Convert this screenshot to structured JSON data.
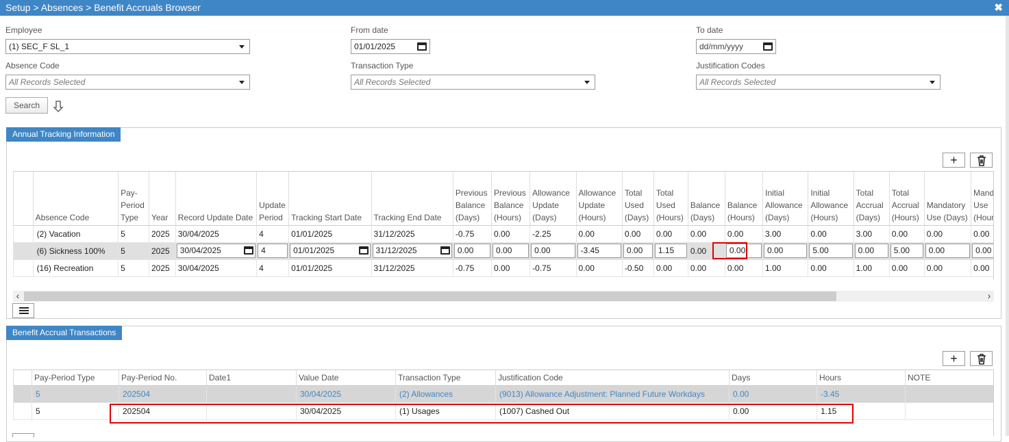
{
  "window": {
    "title": "Setup > Absences > Benefit Accruals Browser",
    "close_symbol": "✖"
  },
  "filters": {
    "employee": {
      "label": "Employee",
      "value": "(1) SEC_F SL_1"
    },
    "from_date": {
      "label": "From date",
      "value": "01/01/2025"
    },
    "to_date": {
      "label": "To date",
      "placeholder": "dd/mm/yyyy"
    },
    "absence_code": {
      "label": "Absence Code",
      "value": "All Records Selected"
    },
    "transaction_type": {
      "label": "Transaction Type",
      "value": "All Records Selected"
    },
    "justification_codes": {
      "label": "Justification Codes",
      "value": "All Records Selected"
    },
    "search_label": "Search"
  },
  "annual": {
    "tab_label": "Annual Tracking Information",
    "columns": [
      "",
      "Absence Code",
      "Pay-Period Type",
      "Year",
      "Record Update Date",
      "Update Period",
      "Tracking Start Date",
      "Tracking End Date",
      "Previous Balance (Days)",
      "Previous Balance (Hours)",
      "Allowance Update (Days)",
      "Allowance Update (Hours)",
      "Total Used (Days)",
      "Total Used (Hours)",
      "Balance (Days)",
      "Balance (Hours)",
      "Initial Allowance (Days)",
      "Initial Allowance (Hours)",
      "Total Accrual (Days)",
      "Total Accrual (Hours)",
      "Mandatory Use (Days)",
      "Mandatory Use (Hours)"
    ],
    "rows": [
      [
        "",
        "(2) Vacation",
        "5",
        "2025",
        "30/04/2025",
        "4",
        "01/01/2025",
        "31/12/2025",
        "-0.75",
        "0.00",
        "-2.25",
        "0.00",
        "0.00",
        "0.00",
        "0.00",
        "0.00",
        "3.00",
        "0.00",
        "3.00",
        "0.00",
        "0.00",
        "0.00"
      ],
      [
        "",
        "(6) Sickness 100%",
        "5",
        "2025",
        "30/04/2025",
        "4",
        "01/01/2025",
        "31/12/2025",
        "0.00",
        "0.00",
        "0.00",
        "-3.45",
        "0.00",
        "1.15",
        "0.00",
        "0.00",
        "0.00",
        "5.00",
        "0.00",
        "5.00",
        "0.00",
        "0.00"
      ],
      [
        "",
        "(16) Recreation",
        "5",
        "2025",
        "30/04/2025",
        "4",
        "01/01/2025",
        "31/12/2025",
        "-0.75",
        "0.00",
        "-0.75",
        "0.00",
        "-0.50",
        "0.00",
        "0.00",
        "0.00",
        "1.00",
        "0.00",
        "1.00",
        "0.00",
        "0.00",
        "0.00"
      ]
    ]
  },
  "transactions": {
    "tab_label": "Benefit Accrual Transactions",
    "columns": [
      "",
      "Pay-Period Type",
      "Pay-Period No.",
      "Date1",
      "Value Date",
      "Transaction Type",
      "Justification Code",
      "Days",
      "Hours",
      "NOTE"
    ],
    "rows": [
      [
        "",
        "5",
        "202504",
        "",
        "30/04/2025",
        "(2) Allowances",
        "(9013) Allowance Adjustment: Planned Future Workdays",
        "0.00",
        "-3.45",
        ""
      ],
      [
        "",
        "5",
        "202504",
        "",
        "30/04/2025",
        "(1) Usages",
        "(1007) Cashed Out",
        "0.00",
        "1.15",
        ""
      ]
    ]
  },
  "icons": {
    "add": "plus-icon",
    "delete": "trash-icon",
    "calendar": "calendar-icon",
    "list": "list-icon"
  }
}
